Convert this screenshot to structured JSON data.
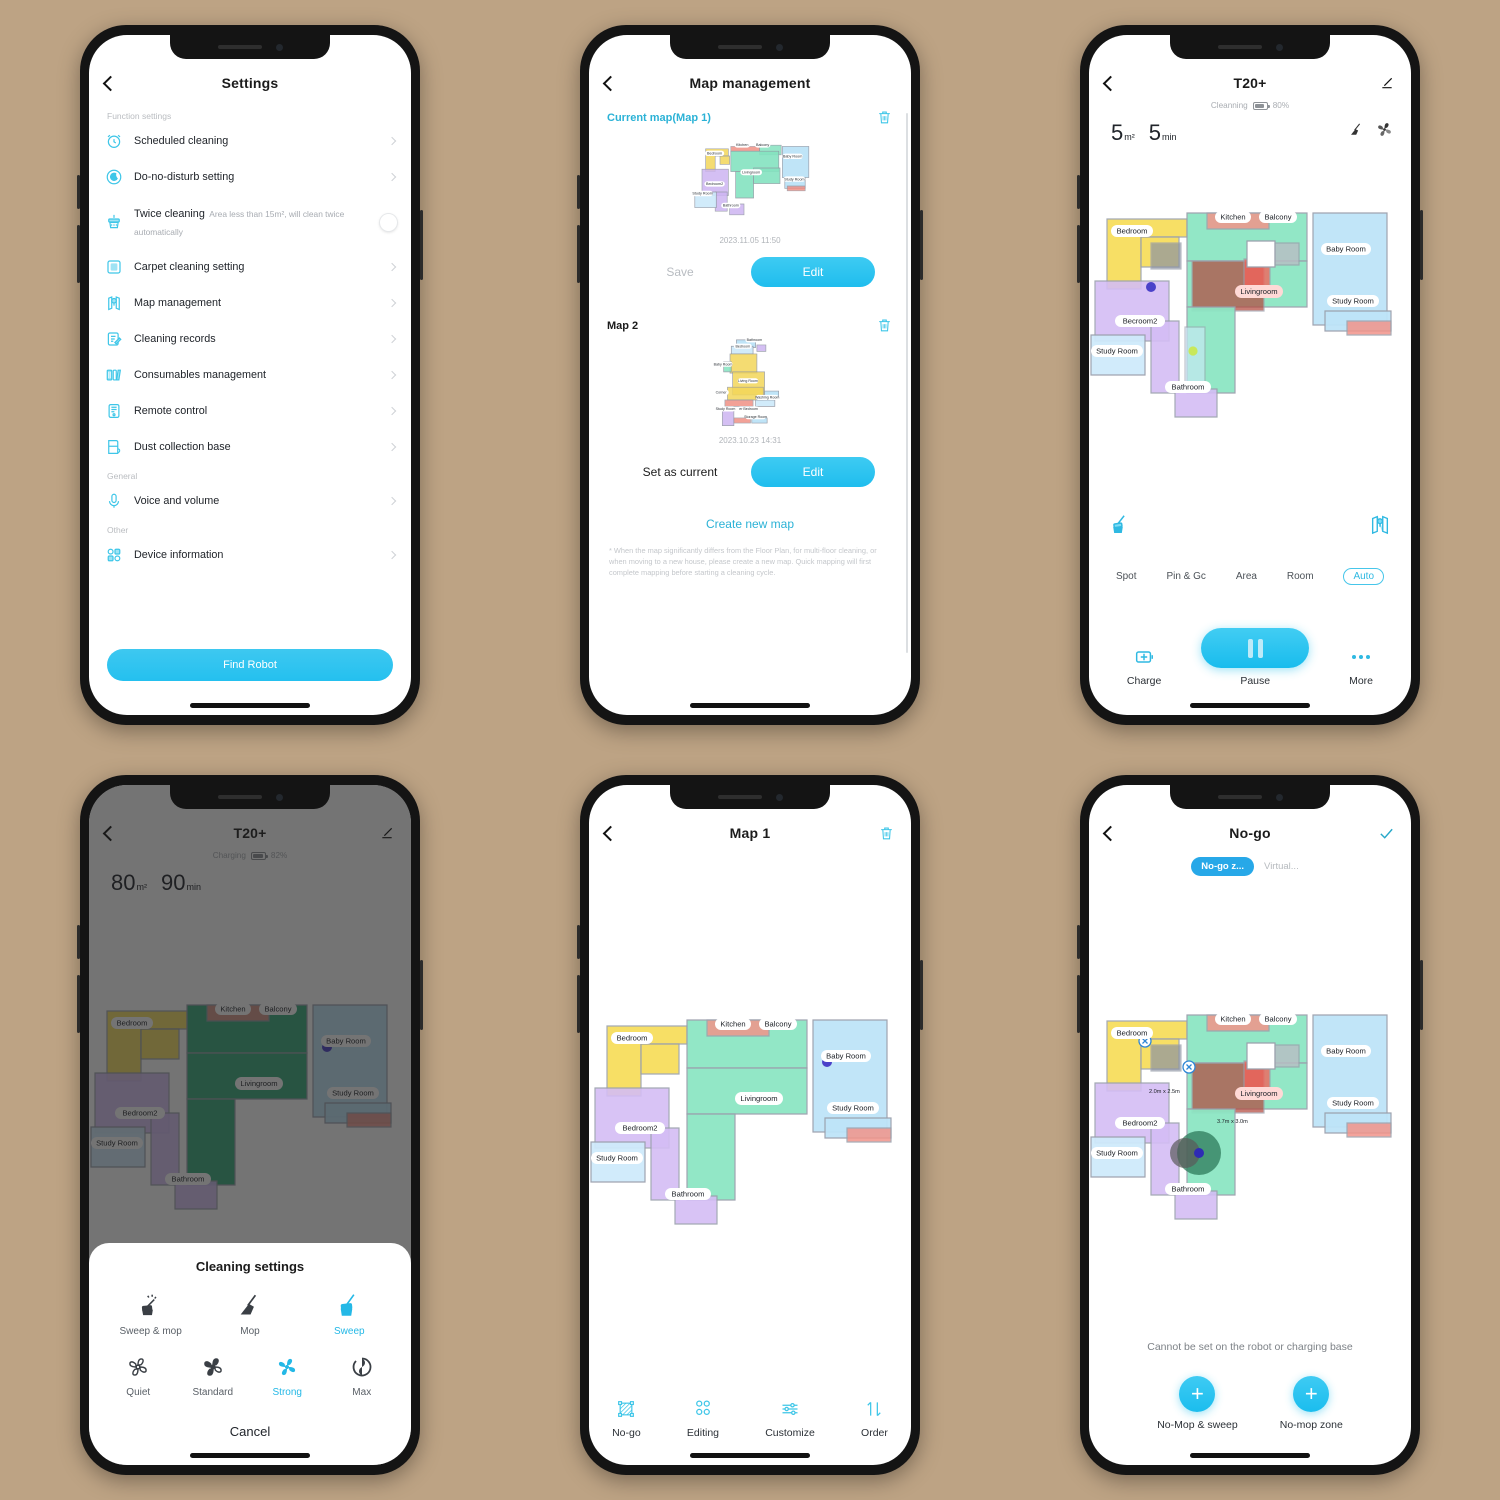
{
  "background_color": "#bda384",
  "accent": "#27bdee",
  "phone1_settings": {
    "nav": {
      "back_icon": "chevron-left-icon",
      "title": "Settings"
    },
    "groups": [
      {
        "label": "Function settings"
      },
      {
        "label": "General"
      },
      {
        "label": "Other"
      }
    ],
    "items": [
      {
        "icon": "alarm-clock-icon",
        "title": "Scheduled cleaning",
        "chevron": true
      },
      {
        "icon": "moon-icon",
        "title": "Do-no-disturb setting",
        "chevron": true
      },
      {
        "icon": "broom-bin-icon",
        "title": "Twice cleaning",
        "subtitle": "Area less than 15m², will clean twice automatically",
        "toggle": false
      },
      {
        "icon": "carpet-icon",
        "title": "Carpet cleaning setting",
        "chevron": true
      },
      {
        "icon": "map-pin-icon",
        "title": "Map management",
        "chevron": true
      },
      {
        "icon": "clipboard-icon",
        "title": "Cleaning records",
        "chevron": true
      },
      {
        "icon": "filter-icon",
        "title": "Consumables management",
        "chevron": true
      },
      {
        "icon": "remote-icon",
        "title": "Remote control",
        "chevron": true
      },
      {
        "icon": "dustbase-icon",
        "title": "Dust collection base",
        "chevron": true
      },
      {
        "icon": "microphone-icon",
        "title": "Voice and volume",
        "chevron": true
      },
      {
        "icon": "info-grid-icon",
        "title": "Device information",
        "chevron": true
      }
    ],
    "find_robot_label": "Find Robot"
  },
  "phone2_map_management": {
    "nav": {
      "back_icon": "chevron-left-icon",
      "title": "Map management"
    },
    "maps": [
      {
        "label": "Current map(Map 1)",
        "date": "2023.11.05 11:50",
        "secondary_label": "Save",
        "primary_label": "Edit",
        "delete_icon": "trash-icon",
        "rooms": [
          "Bedroom",
          "Kitchen",
          "Balcony",
          "Baby Room",
          "Livingroom",
          "Study Room",
          "Bedroom2",
          "Study Room",
          "Bathroom"
        ]
      },
      {
        "label": "Map 2",
        "date": "2023.10.23 14:31",
        "secondary_label": "Set as current",
        "primary_label": "Edit",
        "delete_icon": "trash-icon",
        "rooms": [
          "Bathroom",
          "Bedroom",
          "Baby Room",
          "Living Room",
          "Corner",
          "Washing Room",
          "Study Room",
          "er Bedroom",
          "Storage Room"
        ]
      }
    ],
    "create_new_map": "Create new map",
    "note": "* When the map significantly differs from the Floor Plan, for multi-floor cleaning, or when moving to a new house, please create a new map. Quick mapping will first complete mapping before starting a cleaning cycle."
  },
  "phone3_device": {
    "nav": {
      "back_icon": "chevron-left-icon",
      "title": "T20+",
      "edit_icon": "pencil-icon"
    },
    "status_text": "Cleanning",
    "battery_percent": "80%",
    "battery_icon": "battery-icon",
    "stats": [
      {
        "value": "5",
        "unit": "m²"
      },
      {
        "value": "5",
        "unit": "min"
      }
    ],
    "top_icons": [
      "mop-icon",
      "fan-icon"
    ],
    "mid_icons": [
      "broom-icon",
      "map-layers-icon"
    ],
    "modes": [
      "Spot",
      "Pin & Gc",
      "Area",
      "Room"
    ],
    "mode_badge": "Auto",
    "controls": [
      {
        "icon": "charge-icon",
        "label": "Charge"
      },
      {
        "icon": "pause-icon",
        "label": "Pause"
      },
      {
        "icon": "more-icon",
        "label": "More"
      }
    ],
    "map_rooms": [
      "Bedroom",
      "Kitchen",
      "Balcony",
      "Baby Room",
      "Livingroom",
      "Study Room",
      "Becroom2",
      "Study Room",
      "Bathroom"
    ]
  },
  "phone4_cleaning_settings": {
    "nav": {
      "back_icon": "chevron-left-icon",
      "title": "T20+",
      "edit_icon": "pencil-icon"
    },
    "status_text": "Charging",
    "battery_percent": "82%",
    "stats": [
      {
        "value": "80",
        "unit": "m²"
      },
      {
        "value": "90",
        "unit": "min"
      }
    ],
    "sheet_title": "Cleaning settings",
    "modes": [
      {
        "icon": "sweep-mop-icon",
        "label": "Sweep & mop",
        "selected": false
      },
      {
        "icon": "mop-icon",
        "label": "Mop",
        "selected": false
      },
      {
        "icon": "broom-icon",
        "label": "Sweep",
        "selected": true
      }
    ],
    "suction": [
      {
        "icon": "fan-quiet-icon",
        "label": "Quiet",
        "selected": false
      },
      {
        "icon": "fan-standard-icon",
        "label": "Standard",
        "selected": false
      },
      {
        "icon": "fan-strong-icon",
        "label": "Strong",
        "selected": true
      },
      {
        "icon": "fan-max-icon",
        "label": "Max",
        "selected": false
      }
    ],
    "cancel_label": "Cancel"
  },
  "phone5_map1": {
    "nav": {
      "back_icon": "chevron-left-icon",
      "title": "Map 1",
      "delete_icon": "trash-icon"
    },
    "tools": [
      {
        "icon": "nogo-zone-icon",
        "label": "No-go"
      },
      {
        "icon": "editing-icon",
        "label": "Editing"
      },
      {
        "icon": "customize-icon",
        "label": "Customize"
      },
      {
        "icon": "order-icon",
        "label": "Order"
      }
    ],
    "map_rooms": [
      "Bedroom",
      "Kitchen",
      "Balcony",
      "Baby Room",
      "Livingroom",
      "Study Room",
      "Bedroom2",
      "Study Room",
      "Bathroom"
    ]
  },
  "phone6_nogo": {
    "nav": {
      "back_icon": "chevron-left-icon",
      "title": "No-go",
      "confirm_icon": "check-icon"
    },
    "tabs": [
      {
        "label": "No-go z...",
        "active": true
      },
      {
        "label": "Virtual...",
        "active": false
      }
    ],
    "zone_labels": [
      "2.0m x 2.5m",
      "3.7m x 3.0m"
    ],
    "note": "Cannot be set on the robot or charging base",
    "actions": [
      {
        "icon": "plus-icon",
        "label": "No-Mop & sweep"
      },
      {
        "icon": "plus-icon",
        "label": "No-mop zone"
      }
    ],
    "map_rooms": [
      "Bedroom",
      "Kitchen",
      "Balcony",
      "Baby Room",
      "Livingroom",
      "Study Room",
      "Bedroom2",
      "Study Room",
      "Bathroom"
    ]
  }
}
